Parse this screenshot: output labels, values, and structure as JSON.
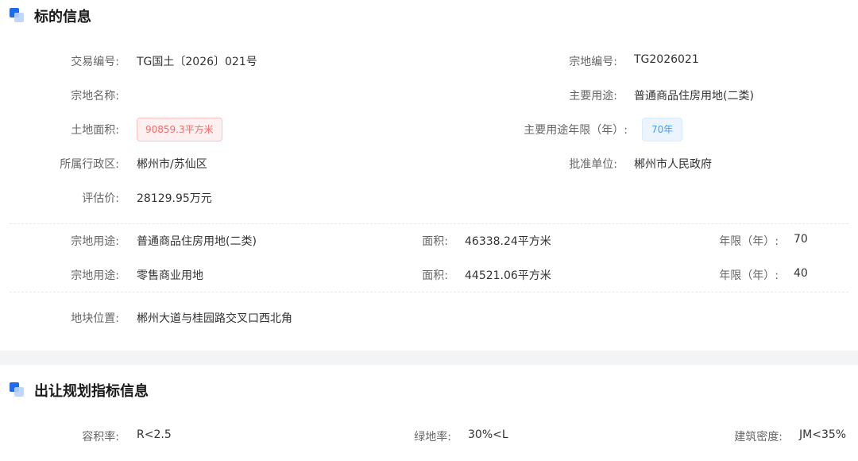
{
  "section1": {
    "title": "标的信息",
    "fields": {
      "trade_no": {
        "label": "交易编号:",
        "value": "TG国土〔2026〕021号"
      },
      "parcel_no": {
        "label": "宗地编号:",
        "value": "TG2026021"
      },
      "parcel_name": {
        "label": "宗地名称:",
        "value": ""
      },
      "main_use": {
        "label": "主要用途:",
        "value": "普通商品住房用地(二类)"
      },
      "land_area": {
        "label": "土地面积:",
        "value": "90859.3平方米"
      },
      "main_use_term": {
        "label": "主要用途年限（年）:",
        "value": "70年"
      },
      "district": {
        "label": "所属行政区:",
        "value": "郴州市/苏仙区"
      },
      "approver": {
        "label": "批准单位:",
        "value": "郴州市人民政府"
      },
      "appraisal": {
        "label": "评估价:",
        "value": "28129.95万元"
      }
    },
    "uses": [
      {
        "use_label": "宗地用途:",
        "use": "普通商品住房用地(二类)",
        "area_label": "面积:",
        "area": "46338.24平方米",
        "term_label": "年限（年）:",
        "term": "70"
      },
      {
        "use_label": "宗地用途:",
        "use": "零售商业用地",
        "area_label": "面积:",
        "area": "44521.06平方米",
        "term_label": "年限（年）:",
        "term": "40"
      }
    ],
    "location": {
      "label": "地块位置:",
      "value": "郴州大道与桂园路交叉口西北角"
    }
  },
  "section2": {
    "title": "出让规划指标信息",
    "fields": {
      "far": {
        "label": "容积率:",
        "value": "R<2.5"
      },
      "green_ratio": {
        "label": "绿地率:",
        "value": "30%<L"
      },
      "density": {
        "label": "建筑密度:",
        "value": "JM<35%"
      }
    }
  },
  "colors": {
    "accent": "#1d6bf0",
    "area_tag_text": "#f56c6c",
    "area_tag_bg": "#fef0f0",
    "term_tag_text": "#409eff",
    "term_tag_bg": "#ecf5ff"
  }
}
